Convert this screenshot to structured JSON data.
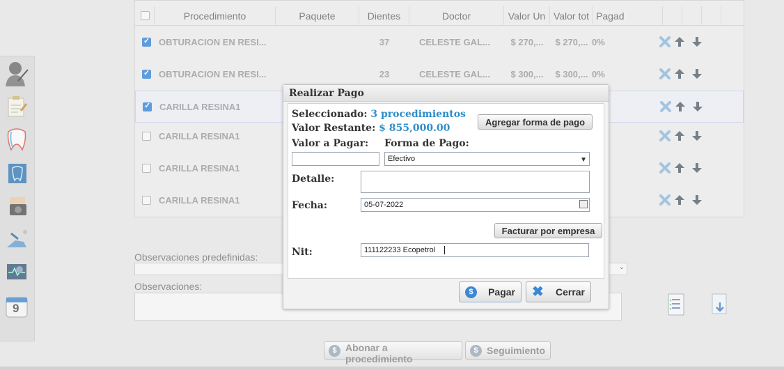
{
  "table": {
    "headers": [
      "Procedimiento",
      "Paquete",
      "Dientes",
      "Doctor",
      "Valor Un",
      "Valor tot",
      "Pagad"
    ],
    "rows": [
      {
        "checked": true,
        "procedure": "OBTURACION EN RESI...",
        "tooth": "37",
        "doctor": "CELESTE GAL...",
        "unit": "$ 270,...",
        "total": "$ 270,...",
        "paid": "0%"
      },
      {
        "checked": true,
        "procedure": "OBTURACION EN RESI...",
        "tooth": "23",
        "doctor": "CELESTE GAL...",
        "unit": "$ 300,...",
        "total": "$ 300,...",
        "paid": "0%"
      },
      {
        "checked": true,
        "procedure": "CARILLA RESINA1",
        "tooth": "",
        "doctor": "",
        "unit": "",
        "total": "",
        "paid": ""
      },
      {
        "checked": false,
        "procedure": "CARILLA RESINA1",
        "tooth": "",
        "doctor": "",
        "unit": "",
        "total": "",
        "paid": ""
      },
      {
        "checked": false,
        "procedure": "CARILLA RESINA1",
        "tooth": "",
        "doctor": "",
        "unit": "",
        "total": "",
        "paid": ""
      },
      {
        "checked": false,
        "procedure": "CARILLA RESINA1",
        "tooth": "",
        "doctor": "",
        "unit": "",
        "total": "",
        "paid": ""
      }
    ],
    "row_actions": [
      "delete-icon",
      "arrow-up-icon",
      "arrow-down-icon"
    ]
  },
  "form": {
    "obs_predef_label": "Observaciones predefinidas:",
    "obs_label": "Observaciones:",
    "abonar_label": "Abonar a procedimiento",
    "seguimiento_label": "Seguimiento"
  },
  "sidebar": {
    "icons": [
      "doctor-icon",
      "clipboard-icon",
      "tooth-icon",
      "xray-icon",
      "camera-icon",
      "dental-chair-icon",
      "monitor-icon",
      "calendar-icon"
    ],
    "calendar_day": "9"
  },
  "modal": {
    "title": "Realizar Pago",
    "selected_label": "Seleccionado:",
    "selected_value": "3 procedimientos",
    "remaining_label": "Valor Restante:",
    "remaining_value": "$ 855,000.00",
    "add_payment_label": "Agregar forma de pago",
    "amount_label": "Valor a Pagar:",
    "amount_value": "",
    "method_label": "Forma de Pago:",
    "method_value": "Efectivo",
    "detail_label": "Detalle:",
    "detail_value": "",
    "date_label": "Fecha:",
    "date_value": "05-07-2022",
    "invoice_company_label": "Facturar por empresa",
    "nit_label": "Nit:",
    "nit_value": "111122233 Ecopetrol",
    "pay_label": "Pagar",
    "close_label": "Cerrar"
  },
  "colors": {
    "accent": "#2f8dc8",
    "checkbox": "#3b87d6",
    "action": "#5a6570",
    "delete": "#8fb8d8"
  }
}
